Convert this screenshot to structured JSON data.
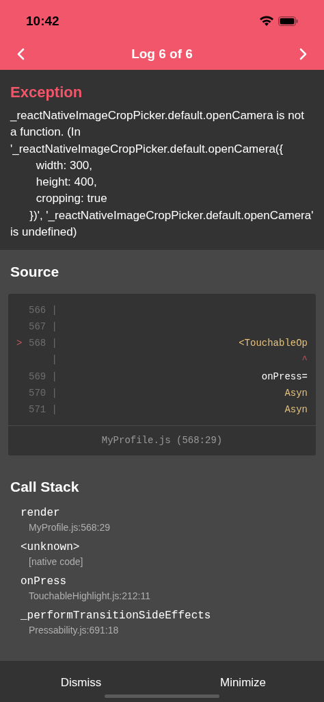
{
  "status_bar": {
    "time": "10:42"
  },
  "nav": {
    "title": "Log 6 of 6"
  },
  "exception": {
    "heading": "Exception",
    "message": "_reactNativeImageCropPicker.default.openCamera is not a function. (In '_reactNativeImageCropPicker.default.openCamera({\n        width: 300,\n        height: 400,\n        cropping: true\n      })', '_reactNativeImageCropPicker.default.openCamera' is undefined)"
  },
  "source": {
    "heading": "Source",
    "lines": [
      {
        "number": "566 |",
        "kind": "plain"
      },
      {
        "number": "567 |",
        "kind": "plain"
      },
      {
        "marker": ">",
        "number": "568 |",
        "code": "<TouchableOp",
        "kind": "tag"
      },
      {
        "number": "    |",
        "code": "^",
        "kind": "caret"
      },
      {
        "number": "569 |",
        "code": "onPress=",
        "kind": "plain"
      },
      {
        "number": "570 |",
        "code": "Asyn",
        "kind": "tag"
      },
      {
        "number": "571 |",
        "code": "Asyn",
        "kind": "tag"
      }
    ],
    "file": "MyProfile.js (568:29)"
  },
  "call_stack": {
    "heading": "Call Stack",
    "frames": [
      {
        "name": "render",
        "location": "MyProfile.js:568:29"
      },
      {
        "name": "<unknown>",
        "location": "[native code]"
      },
      {
        "name": "onPress",
        "location": "TouchableHighlight.js:212:11"
      },
      {
        "name": "_performTransitionSideEffects",
        "location": "Pressability.js:691:18"
      }
    ]
  },
  "buttons": [
    "Dismiss",
    "Minimize"
  ]
}
